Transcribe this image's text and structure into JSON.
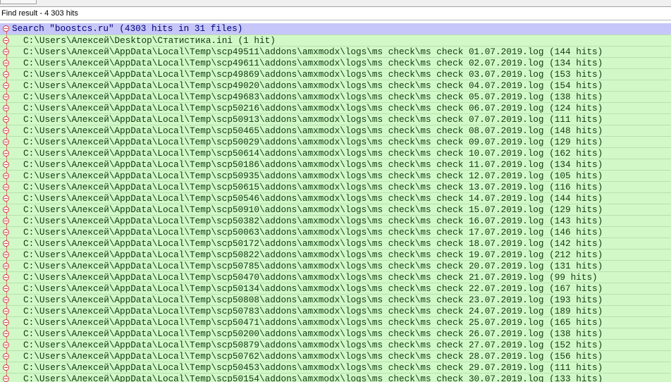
{
  "panel": {
    "title": "Find result - 4 303 hits"
  },
  "search": {
    "header": "Search \"boostcs.ru\" (4303 hits in 31 files)"
  },
  "results": [
    "C:\\Users\\Алексей\\Desktop\\Статистика.ini (1 hit)",
    "C:\\Users\\Алексей\\AppData\\Local\\Temp\\scp49511\\addons\\amxmodx\\logs\\ms check\\ms check 01.07.2019.log (144 hits)",
    "C:\\Users\\Алексей\\AppData\\Local\\Temp\\scp49611\\addons\\amxmodx\\logs\\ms check\\ms check 02.07.2019.log (134 hits)",
    "C:\\Users\\Алексей\\AppData\\Local\\Temp\\scp49869\\addons\\amxmodx\\logs\\ms check\\ms check 03.07.2019.log (153 hits)",
    "C:\\Users\\Алексей\\AppData\\Local\\Temp\\scp49020\\addons\\amxmodx\\logs\\ms check\\ms check 04.07.2019.log (154 hits)",
    "C:\\Users\\Алексей\\AppData\\Local\\Temp\\scp49683\\addons\\amxmodx\\logs\\ms check\\ms check 05.07.2019.log (138 hits)",
    "C:\\Users\\Алексей\\AppData\\Local\\Temp\\scp50216\\addons\\amxmodx\\logs\\ms check\\ms check 06.07.2019.log (124 hits)",
    "C:\\Users\\Алексей\\AppData\\Local\\Temp\\scp50913\\addons\\amxmodx\\logs\\ms check\\ms check 07.07.2019.log (111 hits)",
    "C:\\Users\\Алексей\\AppData\\Local\\Temp\\scp50465\\addons\\amxmodx\\logs\\ms check\\ms check 08.07.2019.log (148 hits)",
    "C:\\Users\\Алексей\\AppData\\Local\\Temp\\scp50029\\addons\\amxmodx\\logs\\ms check\\ms check 09.07.2019.log (129 hits)",
    "C:\\Users\\Алексей\\AppData\\Local\\Temp\\scp50614\\addons\\amxmodx\\logs\\ms check\\ms check 10.07.2019.log (162 hits)",
    "C:\\Users\\Алексей\\AppData\\Local\\Temp\\scp50186\\addons\\amxmodx\\logs\\ms check\\ms check 11.07.2019.log (134 hits)",
    "C:\\Users\\Алексей\\AppData\\Local\\Temp\\scp50935\\addons\\amxmodx\\logs\\ms check\\ms check 12.07.2019.log (105 hits)",
    "C:\\Users\\Алексей\\AppData\\Local\\Temp\\scp50615\\addons\\amxmodx\\logs\\ms check\\ms check 13.07.2019.log (116 hits)",
    "C:\\Users\\Алексей\\AppData\\Local\\Temp\\scp50546\\addons\\amxmodx\\logs\\ms check\\ms check 14.07.2019.log (144 hits)",
    "C:\\Users\\Алексей\\AppData\\Local\\Temp\\scp50910\\addons\\amxmodx\\logs\\ms check\\ms check 15.07.2019.log (129 hits)",
    "C:\\Users\\Алексей\\AppData\\Local\\Temp\\scp50382\\addons\\amxmodx\\logs\\ms check\\ms check 16.07.2019.log (143 hits)",
    "C:\\Users\\Алексей\\AppData\\Local\\Temp\\scp50063\\addons\\amxmodx\\logs\\ms check\\ms check 17.07.2019.log (146 hits)",
    "C:\\Users\\Алексей\\AppData\\Local\\Temp\\scp50172\\addons\\amxmodx\\logs\\ms check\\ms check 18.07.2019.log (142 hits)",
    "C:\\Users\\Алексей\\AppData\\Local\\Temp\\scp50822\\addons\\amxmodx\\logs\\ms check\\ms check 19.07.2019.log (212 hits)",
    "C:\\Users\\Алексей\\AppData\\Local\\Temp\\scp50785\\addons\\amxmodx\\logs\\ms check\\ms check 20.07.2019.log (131 hits)",
    "C:\\Users\\Алексей\\AppData\\Local\\Temp\\scp50470\\addons\\amxmodx\\logs\\ms check\\ms check 21.07.2019.log (99 hits)",
    "C:\\Users\\Алексей\\AppData\\Local\\Temp\\scp50134\\addons\\amxmodx\\logs\\ms check\\ms check 22.07.2019.log (167 hits)",
    "C:\\Users\\Алексей\\AppData\\Local\\Temp\\scp50808\\addons\\amxmodx\\logs\\ms check\\ms check 23.07.2019.log (193 hits)",
    "C:\\Users\\Алексей\\AppData\\Local\\Temp\\scp50783\\addons\\amxmodx\\logs\\ms check\\ms check 24.07.2019.log (189 hits)",
    "C:\\Users\\Алексей\\AppData\\Local\\Temp\\scp50471\\addons\\amxmodx\\logs\\ms check\\ms check 25.07.2019.log (165 hits)",
    "C:\\Users\\Алексей\\AppData\\Local\\Temp\\scp50200\\addons\\amxmodx\\logs\\ms check\\ms check 26.07.2019.log (138 hits)",
    "C:\\Users\\Алексей\\AppData\\Local\\Temp\\scp50879\\addons\\amxmodx\\logs\\ms check\\ms check 27.07.2019.log (152 hits)",
    "C:\\Users\\Алексей\\AppData\\Local\\Temp\\scp50762\\addons\\amxmodx\\logs\\ms check\\ms check 28.07.2019.log (156 hits)",
    "C:\\Users\\Алексей\\AppData\\Local\\Temp\\scp50453\\addons\\amxmodx\\logs\\ms check\\ms check 29.07.2019.log (111 hits)",
    "C:\\Users\\Алексей\\AppData\\Local\\Temp\\scp50154\\addons\\amxmodx\\logs\\ms check\\ms check 30.07.2019.log (133 hits)"
  ],
  "colors": {
    "header_bg": "#c6c6f8",
    "header_text": "#00007a",
    "row_bg": "#d2f8c8",
    "row_text": "#0c3a0c",
    "fold_marker": "#d23a3a"
  },
  "icons": {
    "fold": "collapse-minus-icon"
  }
}
